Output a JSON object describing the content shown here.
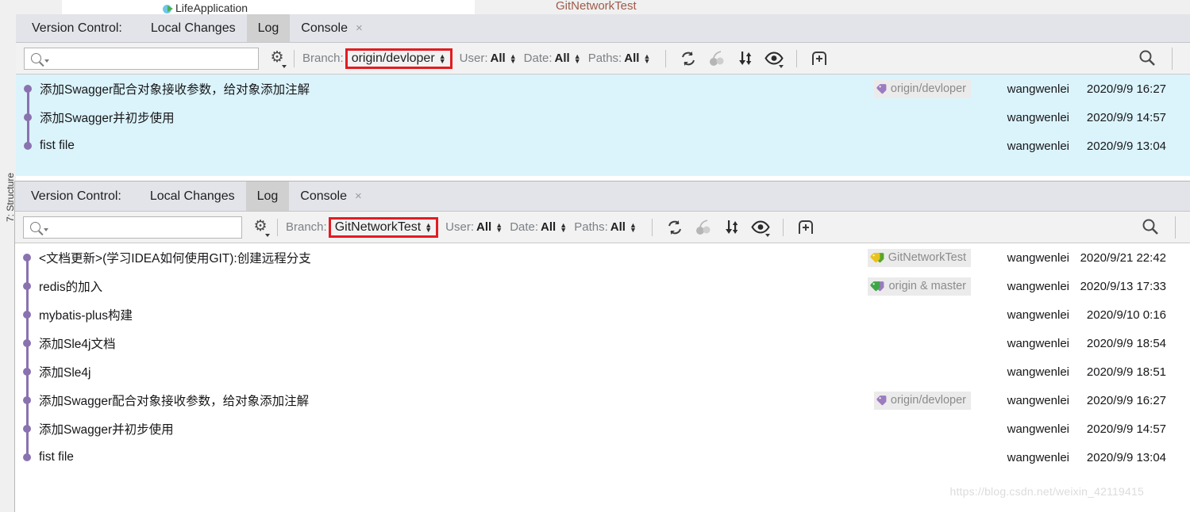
{
  "ide": {
    "run_config_label": "LifeApplication",
    "project_name": "GitNetworkTest",
    "left_rail_label": "7: Structure",
    "watermark": "https://blog.csdn.net/weixin_42119415"
  },
  "panels": [
    {
      "id": "top",
      "tabs": {
        "title": "Version Control:",
        "items": [
          {
            "label": "Local Changes",
            "selected": false,
            "closable": false
          },
          {
            "label": "Log",
            "selected": true,
            "closable": false
          },
          {
            "label": "Console",
            "selected": false,
            "closable": true,
            "close_glyph": "×"
          }
        ]
      },
      "toolbar": {
        "search_placeholder": "",
        "search_value": "",
        "search_icon": "search-icon",
        "settings_icon": "gear-icon",
        "filters": [
          {
            "name": "branch",
            "label": "Branch:",
            "value": "origin/devloper",
            "highlighted": true
          },
          {
            "name": "user",
            "label": "User:",
            "value": "All",
            "highlighted": false
          },
          {
            "name": "date",
            "label": "Date:",
            "value": "All",
            "highlighted": false
          },
          {
            "name": "paths",
            "label": "Paths:",
            "value": "All",
            "highlighted": false
          }
        ],
        "actions": [
          {
            "name": "refresh-icon",
            "enabled": true
          },
          {
            "name": "cherry-pick-icon",
            "enabled": false
          },
          {
            "name": "sort-icon",
            "enabled": true
          },
          {
            "name": "show-details-eye-icon",
            "enabled": true
          },
          {
            "name": "new-branch-icon",
            "enabled": true
          }
        ],
        "right_search_icon": "search-icon"
      },
      "commits": [
        {
          "subject": "添加Swagger配合对象接收参数，给对象添加注解",
          "refs": [
            {
              "label": "origin/devloper",
              "colors": [
                "#9c7bbf"
              ]
            }
          ],
          "author": "wangwenlei",
          "date": "2020/9/9 16:27"
        },
        {
          "subject": "添加Swagger并初步使用",
          "refs": [],
          "author": "wangwenlei",
          "date": "2020/9/9 14:57"
        },
        {
          "subject": "fist file",
          "refs": [],
          "author": "wangwenlei",
          "date": "2020/9/9 13:04"
        }
      ]
    },
    {
      "id": "bottom",
      "tabs": {
        "title": "Version Control:",
        "items": [
          {
            "label": "Local Changes",
            "selected": false,
            "closable": false
          },
          {
            "label": "Log",
            "selected": true,
            "closable": false
          },
          {
            "label": "Console",
            "selected": false,
            "closable": true,
            "close_glyph": "×"
          }
        ]
      },
      "toolbar": {
        "search_placeholder": "",
        "search_value": "",
        "search_icon": "search-icon",
        "settings_icon": "gear-icon",
        "filters": [
          {
            "name": "branch",
            "label": "Branch:",
            "value": "GitNetworkTest",
            "highlighted": true
          },
          {
            "name": "user",
            "label": "User:",
            "value": "All",
            "highlighted": false
          },
          {
            "name": "date",
            "label": "Date:",
            "value": "All",
            "highlighted": false
          },
          {
            "name": "paths",
            "label": "Paths:",
            "value": "All",
            "highlighted": false
          }
        ],
        "actions": [
          {
            "name": "refresh-icon",
            "enabled": true
          },
          {
            "name": "cherry-pick-icon",
            "enabled": false
          },
          {
            "name": "sort-icon",
            "enabled": true
          },
          {
            "name": "show-details-eye-icon",
            "enabled": true
          },
          {
            "name": "new-branch-icon",
            "enabled": true
          }
        ],
        "right_search_icon": "search-icon"
      },
      "commits": [
        {
          "subject": "<文档更新>(学习IDEA如何使用GIT):创建远程分支",
          "refs": [
            {
              "label": "GitNetworkTest",
              "colors": [
                "#e8c31e",
                "#57a62b"
              ]
            }
          ],
          "author": "wangwenlei",
          "date": "2020/9/21 22:42"
        },
        {
          "subject": "redis的加入",
          "refs": [
            {
              "label": "origin & master",
              "colors": [
                "#3fa648",
                "#9c7bbf"
              ]
            }
          ],
          "author": "wangwenlei",
          "date": "2020/9/13 17:33"
        },
        {
          "subject": "mybatis-plus构建",
          "refs": [],
          "author": "wangwenlei",
          "date": "2020/9/10 0:16"
        },
        {
          "subject": "添加Sle4j文档",
          "refs": [],
          "author": "wangwenlei",
          "date": "2020/9/9 18:54"
        },
        {
          "subject": "添加Sle4j",
          "refs": [],
          "author": "wangwenlei",
          "date": "2020/9/9 18:51"
        },
        {
          "subject": "添加Swagger配合对象接收参数，给对象添加注解",
          "refs": [
            {
              "label": "origin/devloper",
              "colors": [
                "#9c7bbf"
              ]
            }
          ],
          "author": "wangwenlei",
          "date": "2020/9/9 16:27"
        },
        {
          "subject": "添加Swagger并初步使用",
          "refs": [],
          "author": "wangwenlei",
          "date": "2020/9/9 14:57"
        },
        {
          "subject": "fist file",
          "refs": [],
          "author": "wangwenlei",
          "date": "2020/9/9 13:04"
        }
      ]
    }
  ],
  "colors": {
    "highlight_border": "#e21c21",
    "selection_bg": "#dbf4fb",
    "graph_node": "#8a72b0",
    "tab_selected_bg": "#d0d0d0",
    "tabbar_bg": "#e2e4ea"
  }
}
